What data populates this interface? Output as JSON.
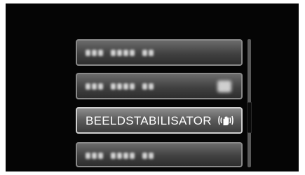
{
  "menu": {
    "items": [
      {
        "label": "",
        "blurred": true,
        "has_icon": false
      },
      {
        "label": "",
        "blurred": true,
        "has_icon": true
      },
      {
        "label": "BEELDSTABILISATOR",
        "blurred": false,
        "selected": true,
        "icon": "image-stabilizer-hand-icon"
      },
      {
        "label": "",
        "blurred": true,
        "has_icon": false
      }
    ]
  },
  "scrollbar": {
    "position_fraction": 0.5
  },
  "colors": {
    "screen_bg": "#050505",
    "item_bg": "#4a4a4a",
    "selected_border": "#cfcfcf"
  }
}
